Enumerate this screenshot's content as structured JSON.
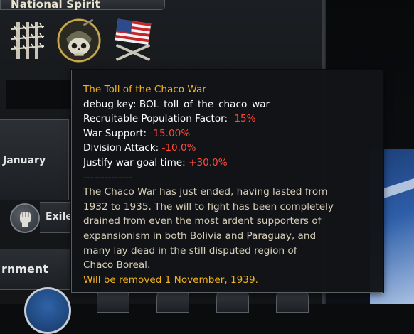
{
  "background": {
    "national_spirit_header": "National Spirit",
    "date_month": "January",
    "exile_label": "Exile",
    "government_label": "rnment"
  },
  "spirits": [
    {
      "icon": "barbed-wire-spirit-icon"
    },
    {
      "icon": "skull-helmet-spirit-icon"
    },
    {
      "icon": "us-flag-crossed-rifles-spirit-icon"
    }
  ],
  "tooltip": {
    "title": "The Toll of the Chaco War",
    "debug_key_label": "debug key: ",
    "debug_key_value": "BOL_toll_of_the_chaco_war",
    "modifiers": [
      {
        "label": "Recruitable Population Factor: ",
        "value": "-15%"
      },
      {
        "label": "War Support: ",
        "value": "-15.00%"
      },
      {
        "label": "Division Attack: ",
        "value": "-10.0%"
      },
      {
        "label": "Justify war goal time: ",
        "value": "+30.0%"
      }
    ],
    "separator": "--------------",
    "description_lines": [
      "The Chaco War has just ended, having lasted from",
      "1932 to 1935. The will to fight has been completely",
      "drained from even the most ardent supporters of",
      "expansionism in both Bolivia and Paraguay, and",
      "many lay dead in the still disputed region of",
      "Chaco Boreal."
    ],
    "removal_notice": "Will be removed 1 November, 1939.",
    "colors": {
      "title": "#f2b21d",
      "negative": "#ff4a3c",
      "description": "#d7cfb8"
    }
  }
}
